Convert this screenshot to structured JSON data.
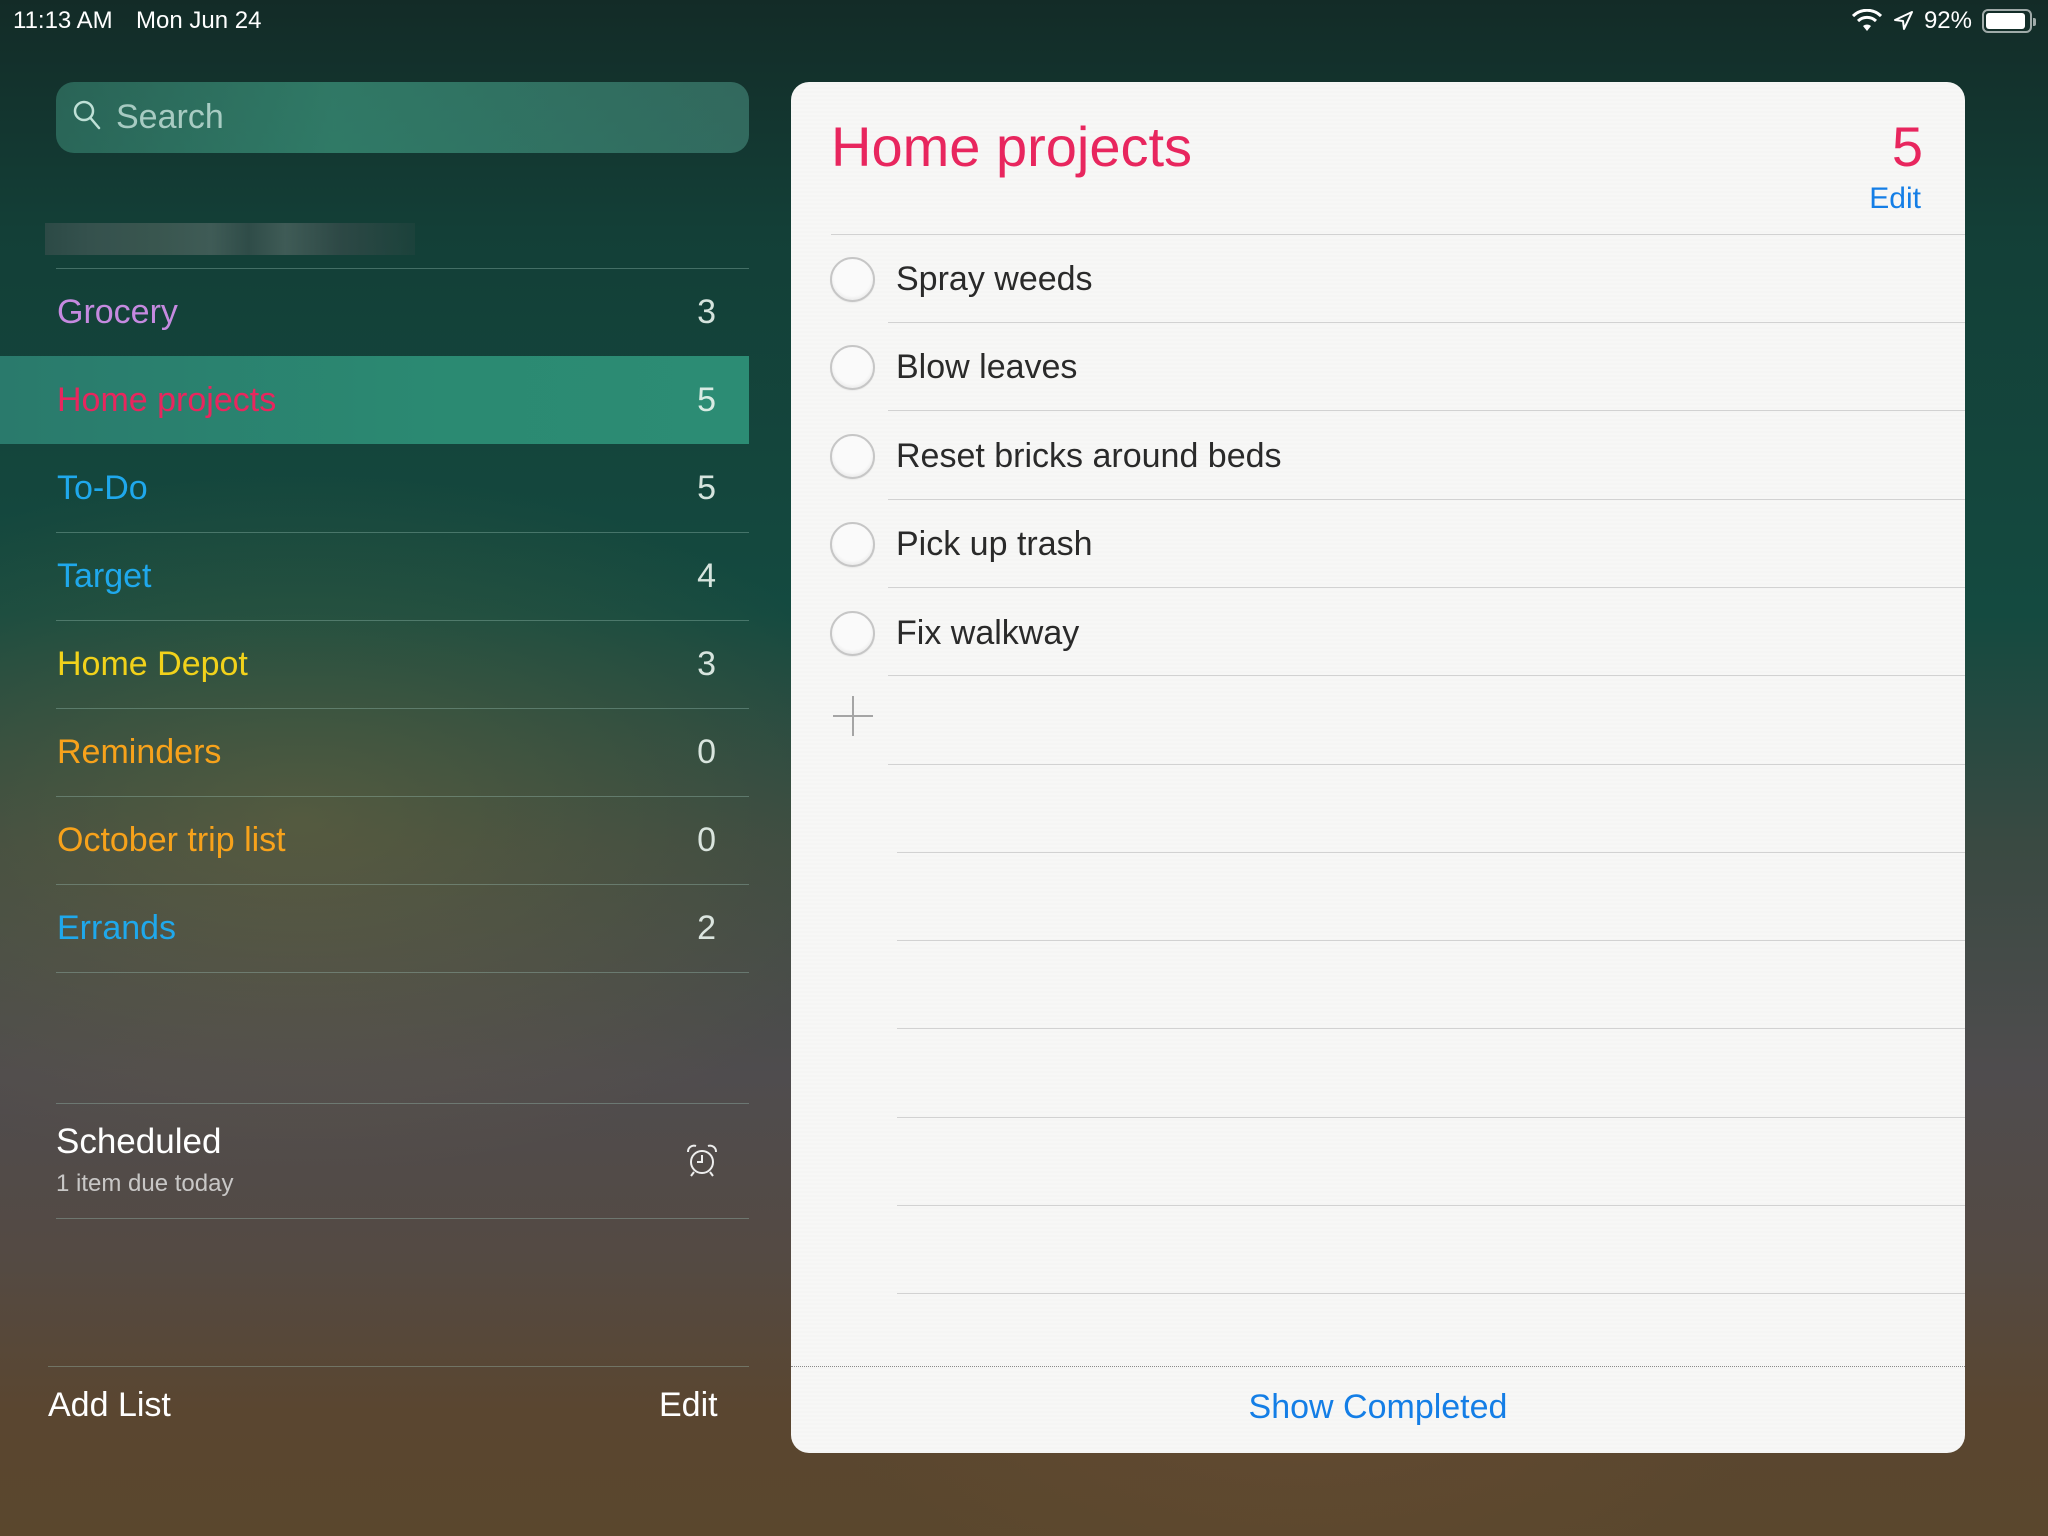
{
  "status_bar": {
    "time": "11:13 AM",
    "date": "Mon Jun 24",
    "battery_percent_label": "92%",
    "battery_level": 0.92,
    "icons": [
      "wifi-icon",
      "location-arrow-icon",
      "battery-icon"
    ]
  },
  "sidebar": {
    "search": {
      "placeholder": "Search",
      "value": "",
      "icon": "search-icon"
    },
    "account_name_redacted": true,
    "lists": [
      {
        "label": "Grocery",
        "count": "3",
        "color": "#c58ae0",
        "selected": false
      },
      {
        "label": "Home projects",
        "count": "5",
        "color": "#e8265e",
        "selected": true
      },
      {
        "label": "To-Do",
        "count": "5",
        "color": "#1fa8ec",
        "selected": false
      },
      {
        "label": "Target",
        "count": "4",
        "color": "#1fa8ec",
        "selected": false
      },
      {
        "label": "Home Depot",
        "count": "3",
        "color": "#f1d21b",
        "selected": false
      },
      {
        "label": "Reminders",
        "count": "0",
        "color": "#f7a21b",
        "selected": false
      },
      {
        "label": "October trip list",
        "count": "0",
        "color": "#f7a21b",
        "selected": false
      },
      {
        "label": "Errands",
        "count": "2",
        "color": "#1fa8ec",
        "selected": false
      }
    ],
    "scheduled": {
      "title": "Scheduled",
      "subtitle": "1 item due today",
      "icon": "alarm-clock-icon"
    },
    "add_list_label": "Add List",
    "edit_label": "Edit"
  },
  "panel": {
    "title": "Home projects",
    "count": "5",
    "edit_label": "Edit",
    "accent_color": "#e8265e",
    "link_color": "#147ee6",
    "items": [
      {
        "text": "Spray weeds",
        "completed": false
      },
      {
        "text": "Blow leaves",
        "completed": false
      },
      {
        "text": "Reset bricks around beds",
        "completed": false
      },
      {
        "text": "Pick up trash",
        "completed": false
      },
      {
        "text": "Fix walkway",
        "completed": false
      }
    ],
    "add_icon": "plus-icon",
    "show_completed_label": "Show Completed"
  }
}
